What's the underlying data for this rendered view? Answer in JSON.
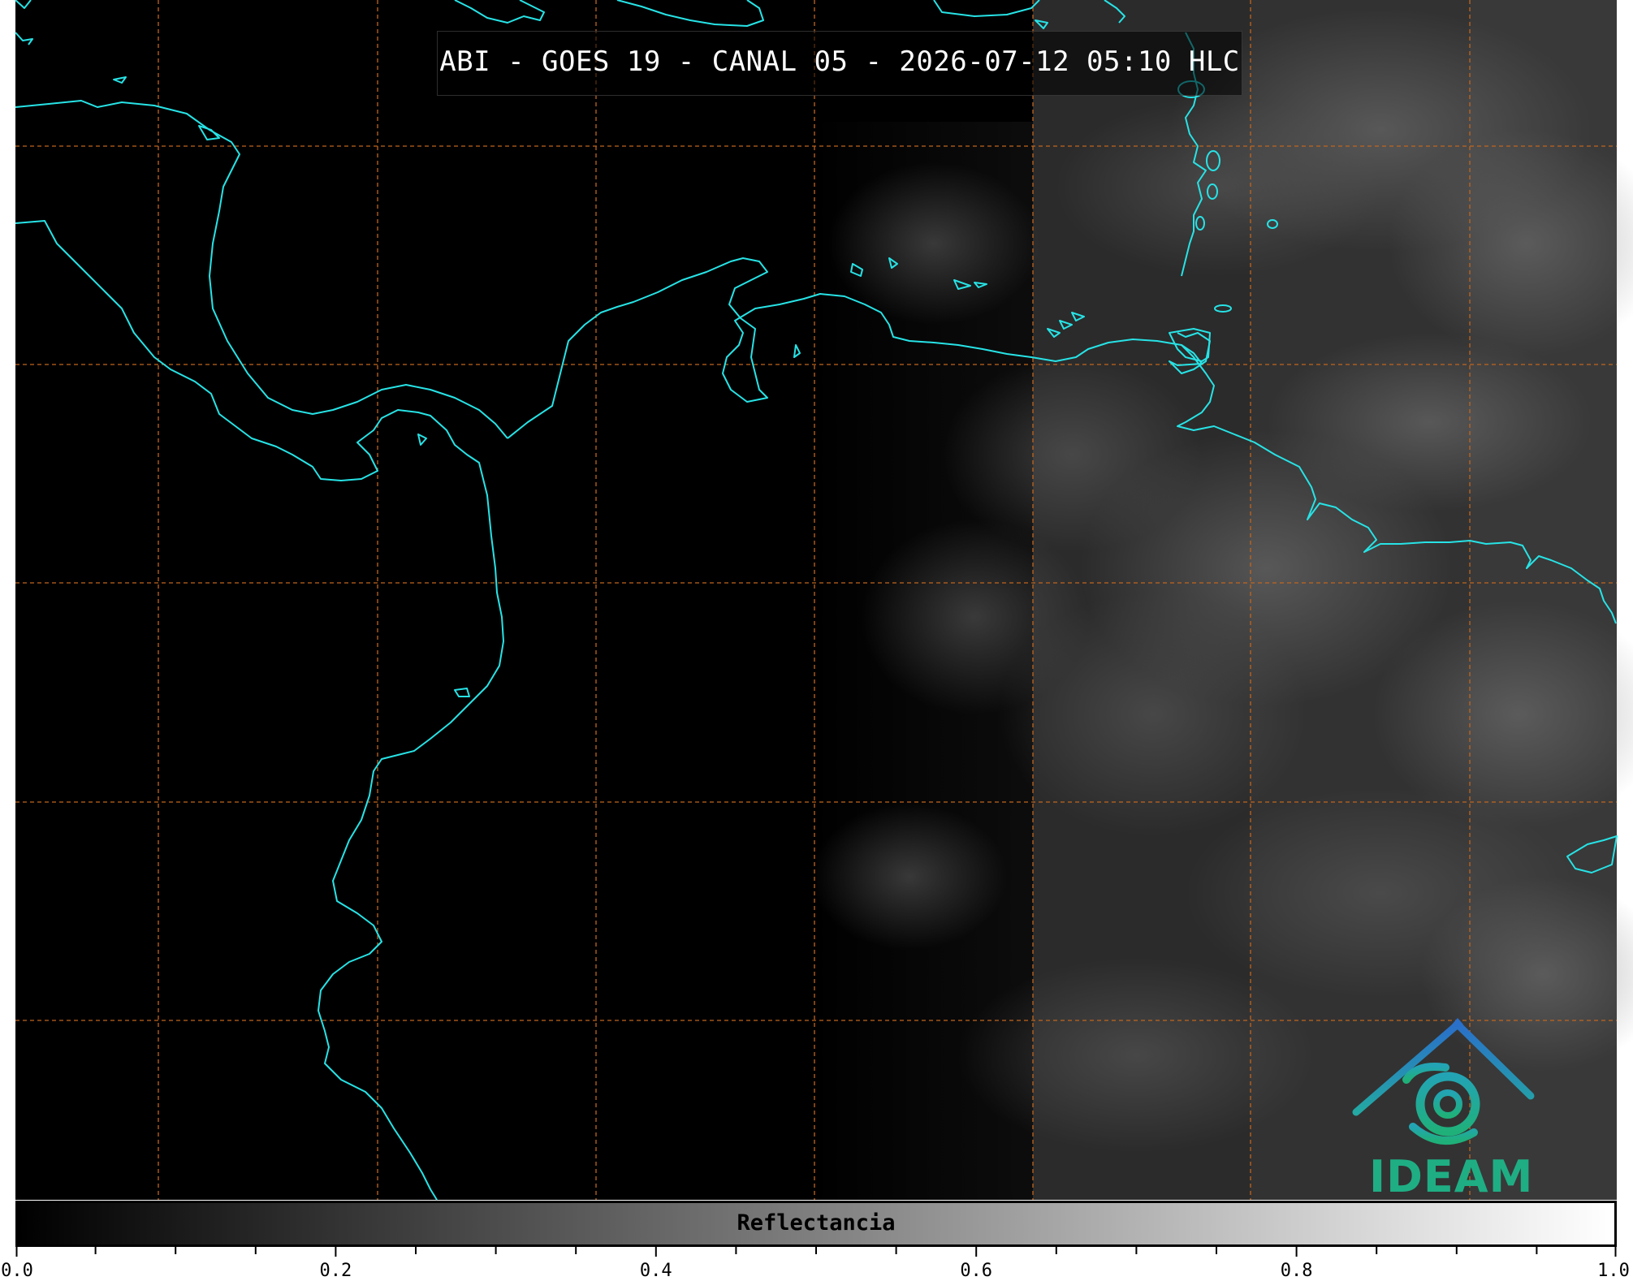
{
  "map": {
    "title": "ABI - GOES 19 - CANAL 05 - 2026-07-12 05:10 HLC",
    "background_color": "#000000",
    "coastline_color": "#27e3e6",
    "grid_color": "#c0651e",
    "grid_style": "dashed",
    "layers": [
      "satellite-reflectance",
      "coastlines",
      "graticule"
    ]
  },
  "colorbar": {
    "label": "Reflectancia",
    "colormap": [
      "#000000",
      "#ffffff"
    ],
    "range": [
      0.0,
      1.0
    ],
    "tick_labels": [
      "0.0",
      "0.2",
      "0.4",
      "0.6",
      "0.8",
      "1.0"
    ],
    "tick_values": [
      0.0,
      0.2,
      0.4,
      0.6,
      0.8,
      1.0
    ],
    "minor_tick_step": 0.05
  },
  "logo": {
    "text": "IDEAM",
    "colors": [
      "#2a78c8",
      "#1fae84"
    ]
  }
}
